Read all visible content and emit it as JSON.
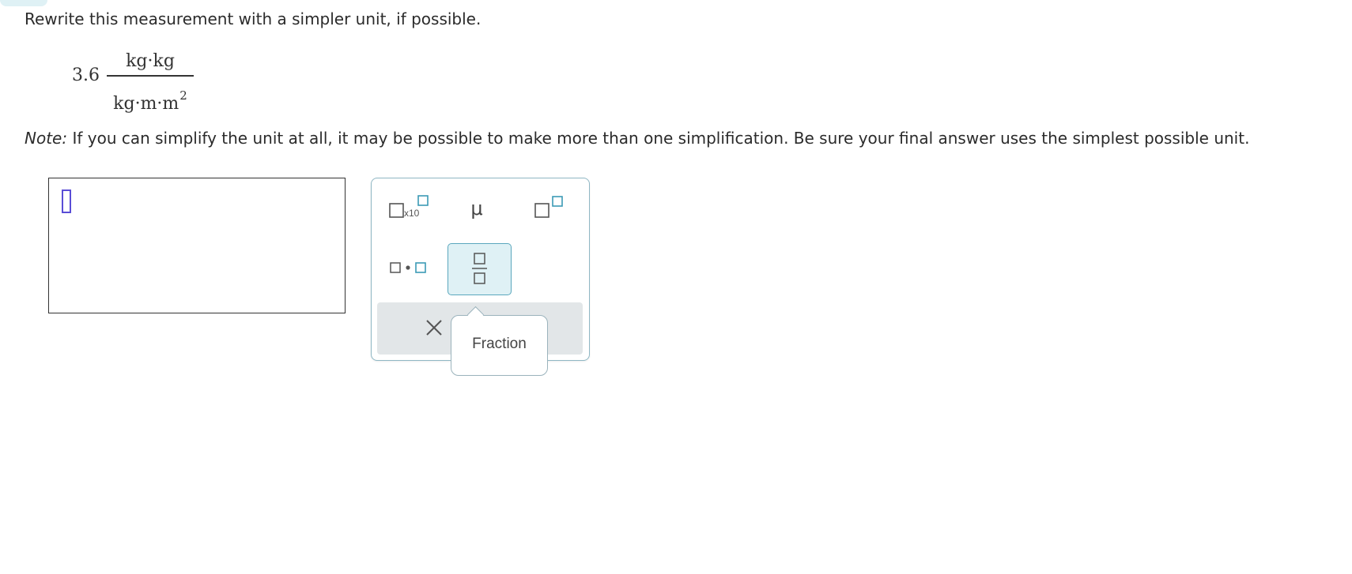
{
  "question": {
    "instruction": "Rewrite this measurement with a simpler unit, if possible.",
    "measurement": {
      "value": "3.6",
      "numerator": "kg·kg",
      "denominator_base": "kg·m·m",
      "denominator_exponent": "2"
    },
    "note_label": "Note:",
    "note_text": " If you can simplify the unit at all, it may be possible to make more than one simplification. Be sure your final answer uses the simplest possible unit."
  },
  "answer": {
    "value": ""
  },
  "palette": {
    "buttons": [
      {
        "id": "scientific-notation",
        "label": "x10",
        "icon": "box-times-ten-power-icon"
      },
      {
        "id": "micro",
        "label": "μ",
        "icon": "mu-symbol"
      },
      {
        "id": "superscript",
        "icon": "superscript-box-icon"
      },
      {
        "id": "multiply-dot",
        "icon": "dot-product-boxes-icon"
      },
      {
        "id": "fraction",
        "icon": "fraction-boxes-icon",
        "active": true
      }
    ],
    "clear_icon": "close-icon",
    "tooltip": "Fraction"
  },
  "colors": {
    "accent": "#3b9ab5",
    "active_bg": "#dff1f5",
    "caret": "#5a4dd6",
    "action_bar": "#e2e6e8"
  }
}
